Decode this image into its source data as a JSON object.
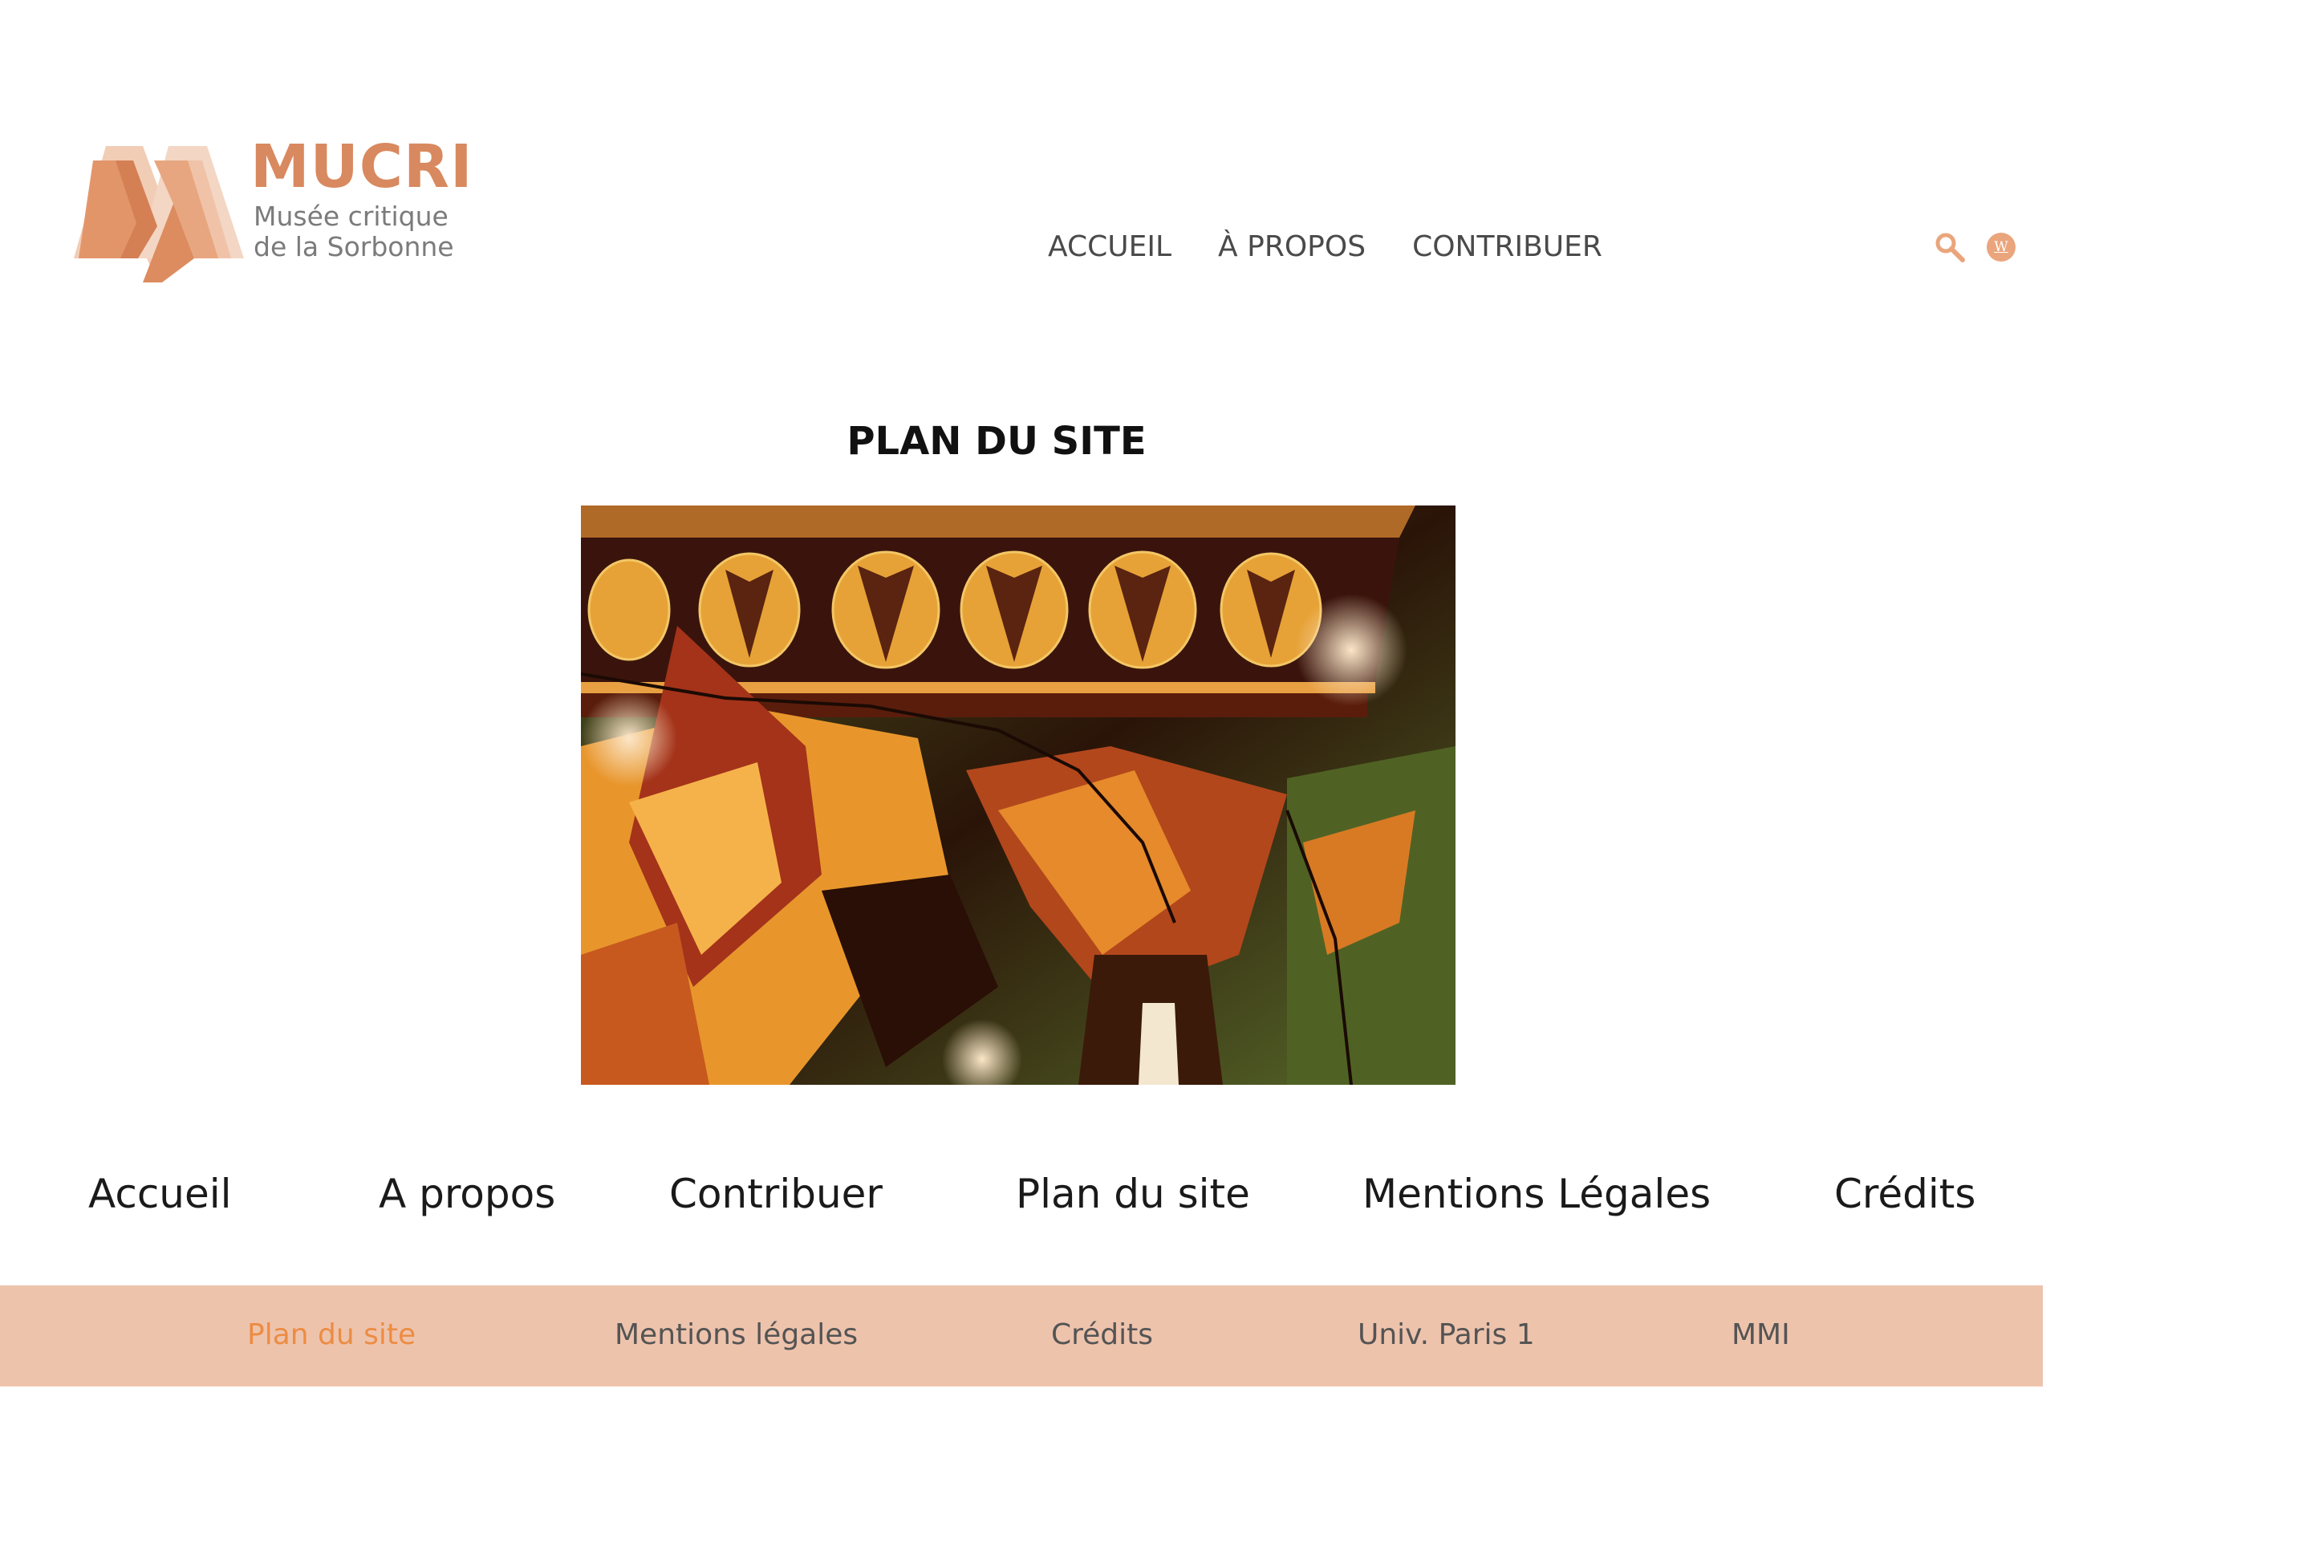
{
  "header": {
    "logo": {
      "title": "MUCRI",
      "subtitle_line1": "Musée critique",
      "subtitle_line2": "de la Sorbonne"
    },
    "nav": [
      {
        "label": "ACCUEIL"
      },
      {
        "label": "À PROPOS"
      },
      {
        "label": "CONTRIBUER"
      }
    ],
    "search_icon": "search-icon",
    "language_badge": "W"
  },
  "main": {
    "title": "PLAN DU SITE",
    "image_description_icon": "painted-vase-fragment-image"
  },
  "sitemap_links": [
    {
      "label": "Accueil"
    },
    {
      "label": "A propos"
    },
    {
      "label": "Contribuer"
    },
    {
      "label": "Plan du site"
    },
    {
      "label": "Mentions Légales"
    },
    {
      "label": "Crédits"
    }
  ],
  "footer": {
    "links": [
      {
        "label": "Plan du site",
        "active": true
      },
      {
        "label": "Mentions légales",
        "active": false
      },
      {
        "label": "Crédits",
        "active": false
      },
      {
        "label": "Univ. Paris 1",
        "active": false
      },
      {
        "label": "MMI",
        "active": false
      }
    ]
  },
  "colors": {
    "accent": "#ec8c43",
    "logo": "#d9895f",
    "footer_band": "#eec3ac",
    "nav_text": "#4a4a4a"
  }
}
